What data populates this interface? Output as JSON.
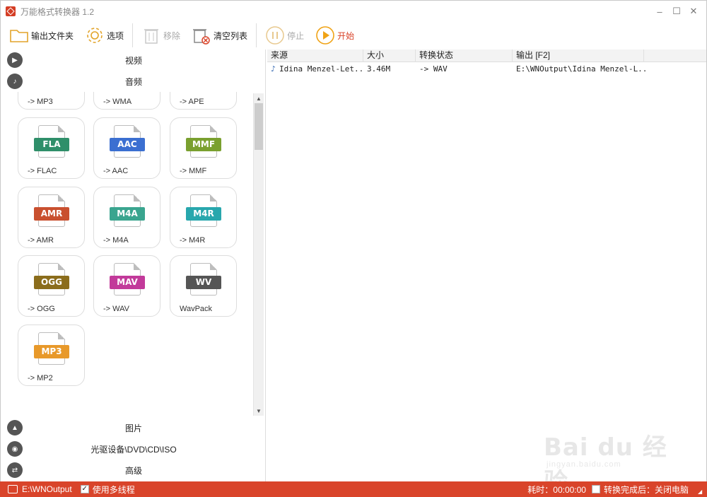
{
  "window": {
    "title": "万能格式转换器 1.2",
    "controls": {
      "minimize": "–",
      "maximize": "☐",
      "close": "✕"
    }
  },
  "toolbar": {
    "output_folder_label": "输出文件夹",
    "options_label": "选项",
    "remove_label": "移除",
    "clear_list_label": "清空列表",
    "stop_label": "停止",
    "start_label": "开始"
  },
  "categories": {
    "video": "视频",
    "audio": "音频",
    "image": "图片",
    "disc": "光驱设备\\DVD\\CD\\ISO",
    "advanced": "高级"
  },
  "formats_partial_row": [
    {
      "label": "-> MP3"
    },
    {
      "label": "-> WMA"
    },
    {
      "label": "-> APE"
    }
  ],
  "formats": [
    {
      "badge": "FLA",
      "label": "-> FLAC",
      "color": "#2f8f6a"
    },
    {
      "badge": "AAC",
      "label": "-> AAC",
      "color": "#3b6fd1"
    },
    {
      "badge": "MMF",
      "label": "-> MMF",
      "color": "#7aa02f"
    },
    {
      "badge": "AMR",
      "label": "-> AMR",
      "color": "#c9502f"
    },
    {
      "badge": "M4A",
      "label": "-> M4A",
      "color": "#3aa58f"
    },
    {
      "badge": "M4R",
      "label": "-> M4R",
      "color": "#28a7ad"
    },
    {
      "badge": "OGG",
      "label": "-> OGG",
      "color": "#8b6d1c"
    },
    {
      "badge": "MAV",
      "label": "-> WAV",
      "color": "#c23a9a"
    },
    {
      "badge": "WV",
      "label": "WavPack",
      "color": "#555555"
    },
    {
      "badge": "MP3",
      "label": "-> MP2",
      "color": "#e8992a"
    }
  ],
  "list": {
    "headers": {
      "source": "来源",
      "size": "大小",
      "status": "转换状态",
      "output": "输出 [F2]"
    },
    "rows": [
      {
        "source": "Idina Menzel-Let...",
        "size": "3.46M",
        "status": "-> WAV",
        "output": "E:\\WNOutput\\Idina Menzel-L..."
      }
    ]
  },
  "watermark": {
    "main": "Bai du 经验",
    "sub": "jingyan.baidu.com"
  },
  "statusbar": {
    "output_path": "E:\\WNOutput",
    "multithread_label": "使用多线程",
    "multithread_checked": "✓",
    "elapsed_label": "耗时：00:00:00",
    "shutdown_label": "转换完成后：关闭电脑"
  },
  "colors": {
    "accent": "#d9442a",
    "start_icon": "#f0a316"
  }
}
